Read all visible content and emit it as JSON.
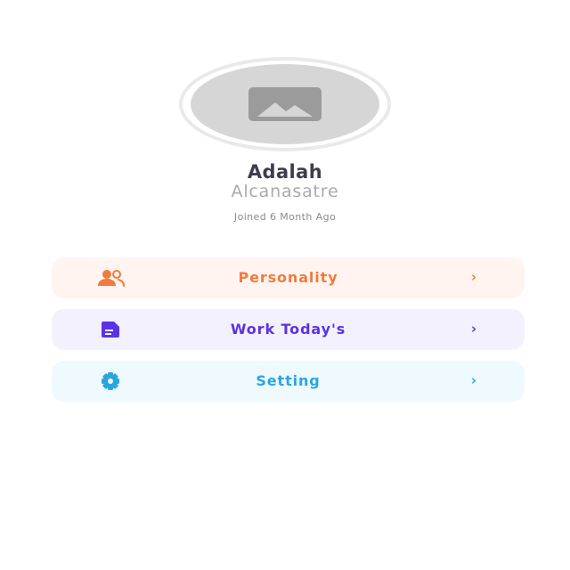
{
  "profile": {
    "avatar_icon": "image-placeholder-icon",
    "name": "Adalah",
    "username": "Alcanasatre",
    "joined": "Joined 6 Month Ago"
  },
  "menu": {
    "items": [
      {
        "label": "Personality",
        "icon": "users-icon",
        "chevron": "›",
        "color": "#f37a3d",
        "background": "#fff4ef"
      },
      {
        "label": "Work Today's",
        "icon": "document-icon",
        "chevron": "›",
        "color": "#5a33e6",
        "background": "#f4f1fe"
      },
      {
        "label": "Setting",
        "icon": "gear-icon",
        "chevron": "›",
        "color": "#2aa6df",
        "background": "#eefaff"
      }
    ]
  }
}
